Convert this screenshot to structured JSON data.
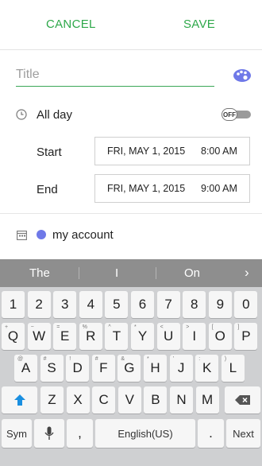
{
  "header": {
    "cancel_label": "CANCEL",
    "save_label": "SAVE"
  },
  "form": {
    "title_placeholder": "Title",
    "all_day": {
      "label": "All day",
      "toggle_label": "OFF"
    },
    "start": {
      "label": "Start",
      "date": "FRI, MAY 1, 2015",
      "time": "8:00 AM"
    },
    "end": {
      "label": "End",
      "date": "FRI, MAY 1, 2015",
      "time": "9:00 AM"
    },
    "calendar_account": "my account"
  },
  "keyboard": {
    "suggestions": [
      "The",
      "I",
      "On"
    ],
    "row_numbers": [
      "1",
      "2",
      "3",
      "4",
      "5",
      "6",
      "7",
      "8",
      "9",
      "0"
    ],
    "row_q": [
      "Q",
      "W",
      "E",
      "R",
      "T",
      "Y",
      "U",
      "I",
      "O",
      "P"
    ],
    "row_q_hints": [
      "+",
      "−",
      "=",
      "%",
      "^",
      "*",
      "<",
      ">",
      "[",
      "]"
    ],
    "row_a": [
      "A",
      "S",
      "D",
      "F",
      "G",
      "H",
      "J",
      "K",
      "L"
    ],
    "row_a_hints": [
      "@",
      "#",
      "!",
      "#",
      "&",
      "*",
      "'",
      ":",
      ")"
    ],
    "row_z": [
      "Z",
      "X",
      "C",
      "V",
      "B",
      "N",
      "M"
    ],
    "sym_label": "Sym",
    "comma": ",",
    "space_label": "English(US)",
    "period": ".",
    "next_label": "Next"
  },
  "colors": {
    "accent": "#2ea84a",
    "account_dot": "#6f79e8"
  }
}
